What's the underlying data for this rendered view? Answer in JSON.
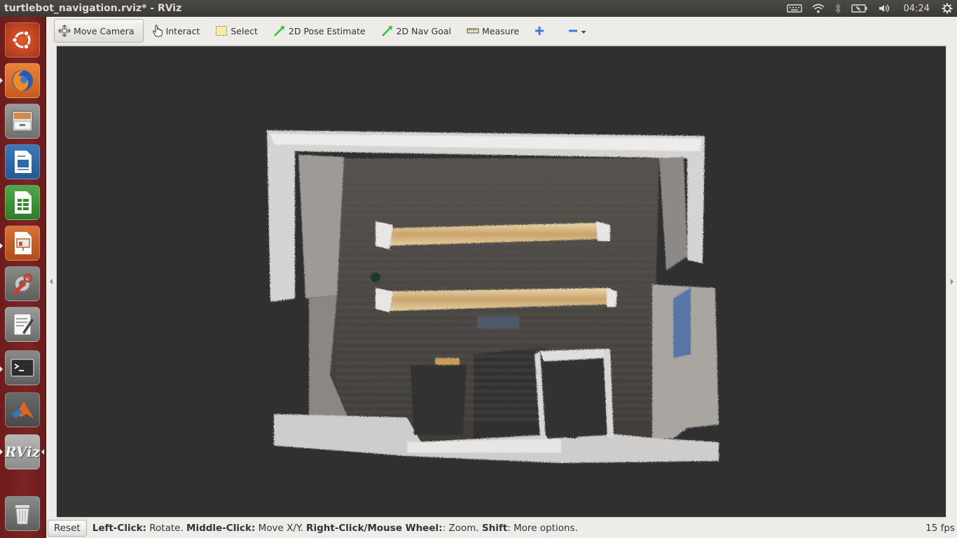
{
  "window": {
    "title": "turtlebot_navigation.rviz* - RViz"
  },
  "panel": {
    "clock": "04:24"
  },
  "launcher": {
    "items": [
      {
        "name": "ubuntu-dash",
        "icon": "ubuntu-logo-icon"
      },
      {
        "name": "firefox",
        "icon": "firefox-icon"
      },
      {
        "name": "files",
        "icon": "file-cabinet-icon"
      },
      {
        "name": "writer",
        "icon": "document-writer-icon"
      },
      {
        "name": "calc",
        "icon": "spreadsheet-icon"
      },
      {
        "name": "impress",
        "icon": "presentation-icon"
      },
      {
        "name": "system-settings",
        "icon": "settings-wrench-icon"
      },
      {
        "name": "text-editor",
        "icon": "text-editor-icon"
      },
      {
        "name": "terminal",
        "icon": "terminal-icon"
      },
      {
        "name": "matlab",
        "icon": "matlab-icon"
      },
      {
        "name": "rviz",
        "icon": "rviz-icon",
        "label": "RViz"
      },
      {
        "name": "trash",
        "icon": "trash-icon"
      }
    ]
  },
  "toolbar": {
    "move_camera": "Move Camera",
    "interact": "Interact",
    "select": "Select",
    "pose_estimate": "2D Pose Estimate",
    "nav_goal": "2D Nav Goal",
    "measure": "Measure"
  },
  "status": {
    "reset": "Reset",
    "left_click_key": "Left-Click:",
    "left_click_val": " Rotate. ",
    "middle_click_key": "Middle-Click:",
    "middle_click_val": " Move X/Y. ",
    "right_click_key": "Right-Click/Mouse Wheel:",
    "right_click_val": ": Zoom. ",
    "shift_key": "Shift",
    "shift_val": ": More options.",
    "fps": "15 fps"
  },
  "colors": {
    "launcher_bg": "#7d2424",
    "viewport_bg": "#303030",
    "toolbar_bg": "#edece9",
    "panel_bg": "#3c3b37"
  }
}
